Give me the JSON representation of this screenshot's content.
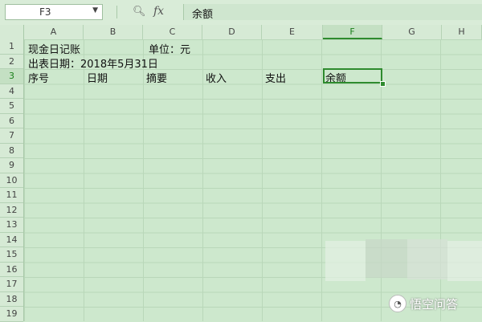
{
  "formula_bar": {
    "name_box": "F3",
    "formula_value": "余额",
    "zoom_icon": "magnifier-icon",
    "fx_label": "fx"
  },
  "columns": [
    "A",
    "B",
    "C",
    "D",
    "E",
    "F",
    "G",
    "H"
  ],
  "active_column": "F",
  "rows": [
    "1",
    "2",
    "3",
    "4",
    "5",
    "6",
    "7",
    "8",
    "9",
    "10",
    "11",
    "12",
    "13",
    "14",
    "15",
    "16",
    "17",
    "18",
    "19"
  ],
  "active_row": "3",
  "cells": {
    "a1": "现金日记账",
    "c1": "单位：元",
    "a2": "出表日期：2018年5月31日",
    "a3": "序号",
    "b3": "日期",
    "c3": "摘要",
    "d3": "收入",
    "e3": "支出",
    "f3": "余额"
  },
  "watermark": {
    "text": "悟空问答"
  },
  "colors": {
    "grid_bg": "#cde8cd",
    "selection": "#2e8b2e"
  }
}
